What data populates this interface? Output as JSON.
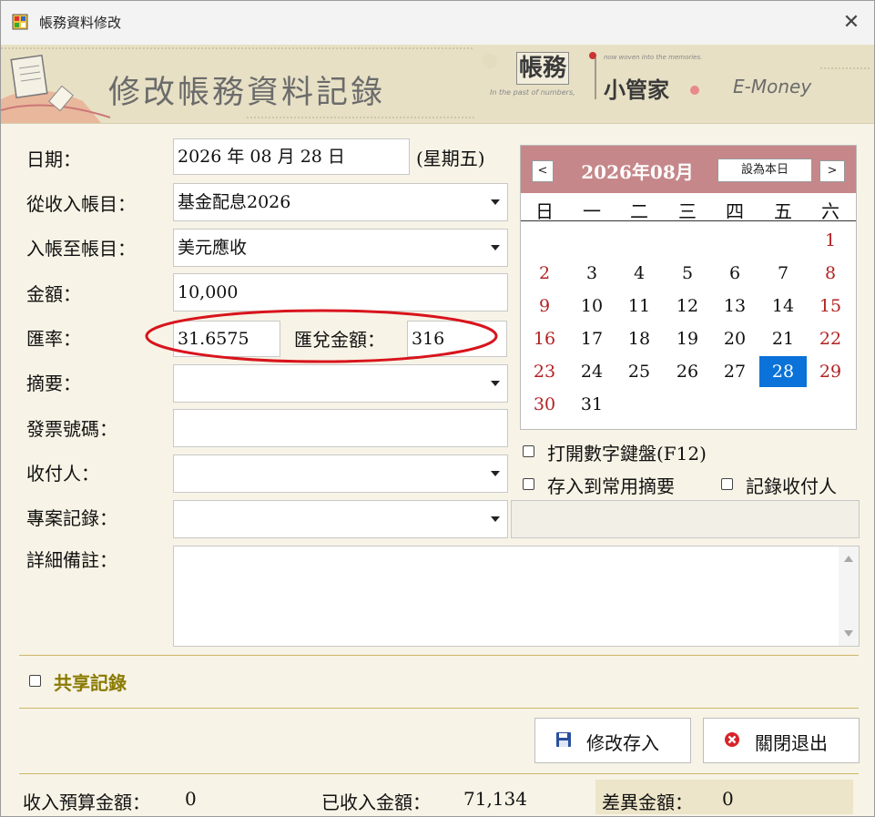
{
  "window": {
    "title": "帳務資料修改",
    "close_glyph": "✕"
  },
  "banner": {
    "title": "修改帳務資料記錄",
    "logo_box": "帳務",
    "logo_main": "小管家",
    "logo_en": "E-Money",
    "logo_tag1": "now woven into the memories.",
    "logo_tag2": "In the past of numbers,"
  },
  "form": {
    "date": {
      "label": "日期：",
      "value": "2026 年 08 月 28 日",
      "weekday": "(星期五)"
    },
    "from_account": {
      "label": "從收入帳目：",
      "value": "基金配息2026"
    },
    "to_account": {
      "label": "入帳至帳目：",
      "value": "美元應收"
    },
    "amount": {
      "label": "金額：",
      "value": "10,000"
    },
    "rate": {
      "label": "匯率：",
      "value": "31.6575"
    },
    "exchange_amount": {
      "label": "匯兌金額：",
      "value": "316"
    },
    "summary": {
      "label": "摘要：",
      "value": ""
    },
    "invoice": {
      "label": "發票號碼：",
      "value": ""
    },
    "payee": {
      "label": "收付人：",
      "value": ""
    },
    "project": {
      "label": "專案記錄：",
      "value": ""
    },
    "notes": {
      "label": "詳細備註：",
      "value": ""
    }
  },
  "calendar": {
    "title": "2026年08月",
    "prev": "<",
    "next": ">",
    "today_button": "設為本日",
    "weekdays": [
      "日",
      "一",
      "二",
      "三",
      "四",
      "五",
      "六"
    ],
    "selected_day": 28
  },
  "options": {
    "numpad": "打開數字鍵盤(F12)",
    "save_summary": "存入到常用摘要",
    "record_payee": "記錄收付人",
    "shared": "共享記錄"
  },
  "buttons": {
    "save": "修改存入",
    "close": "關閉退出"
  },
  "status": {
    "budget_label": "收入預算金額：",
    "budget_value": "0",
    "received_label": "已收入金額：",
    "received_value": "71,134",
    "diff_label": "差異金額：",
    "diff_value": "0"
  },
  "colors": {
    "calendar_header": "#c6878a",
    "selected": "#0a72d8",
    "annotation": "#d8141c",
    "shared_label": "#8a7a00"
  }
}
